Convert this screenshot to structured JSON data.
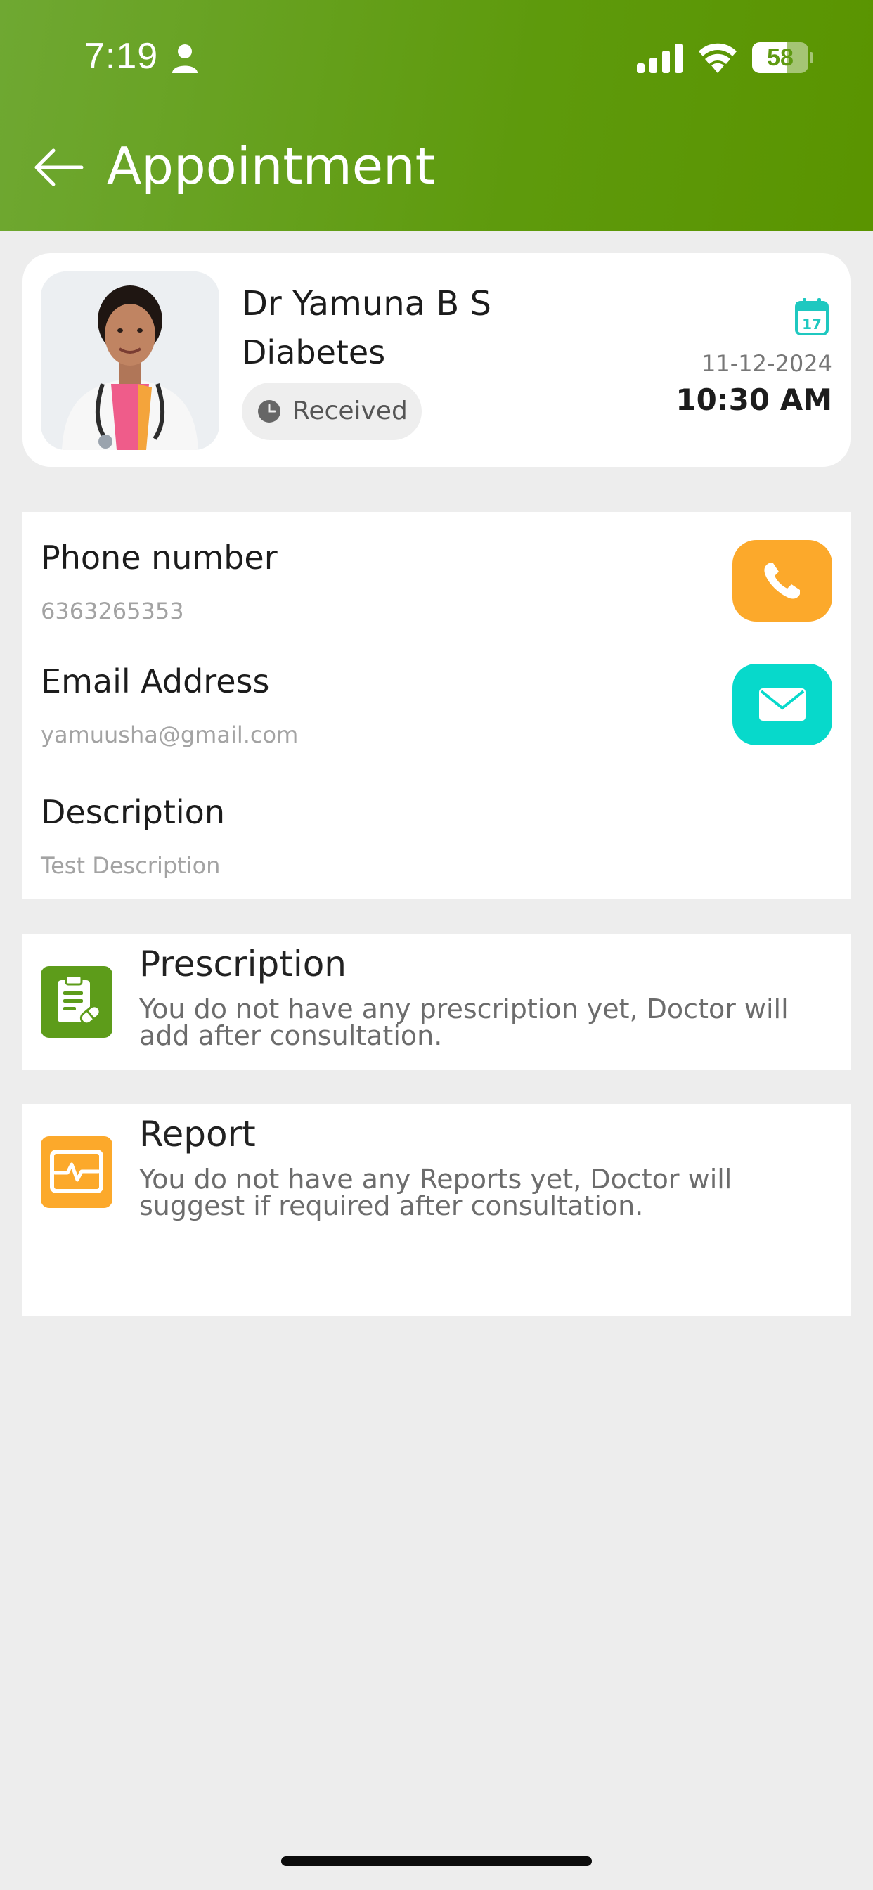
{
  "status_bar": {
    "time": "7:19",
    "battery": "58"
  },
  "header": {
    "title": "Appointment"
  },
  "doctor": {
    "name": "Dr Yamuna B S",
    "specialty": "Diabetes",
    "status": "Received",
    "date": "11-12-2024",
    "time": "10:30 AM"
  },
  "contact": {
    "phone_label": "Phone number",
    "phone_value": "6363265353",
    "email_label": "Email Address",
    "email_value": "yamuusha@gmail.com",
    "description_label": "Description",
    "description_value": "Test Description"
  },
  "prescription": {
    "title": "Prescription",
    "description": "You do not have any prescription yet, Doctor will add after consultation."
  },
  "report": {
    "title": "Report",
    "description": "You do not have any Reports yet, Doctor will suggest if required after consultation."
  },
  "colors": {
    "header_green": "#5e9a0c",
    "call_orange": "#fca92b",
    "email_teal": "#07d9cb",
    "prescription_green": "#5d9c1a",
    "report_orange": "#fca92b"
  },
  "icons": {
    "back": "back-arrow-icon",
    "calendar": "calendar-icon",
    "call": "phone-icon",
    "email": "envelope-icon",
    "prescription": "prescription-icon",
    "report": "report-pulse-icon"
  }
}
